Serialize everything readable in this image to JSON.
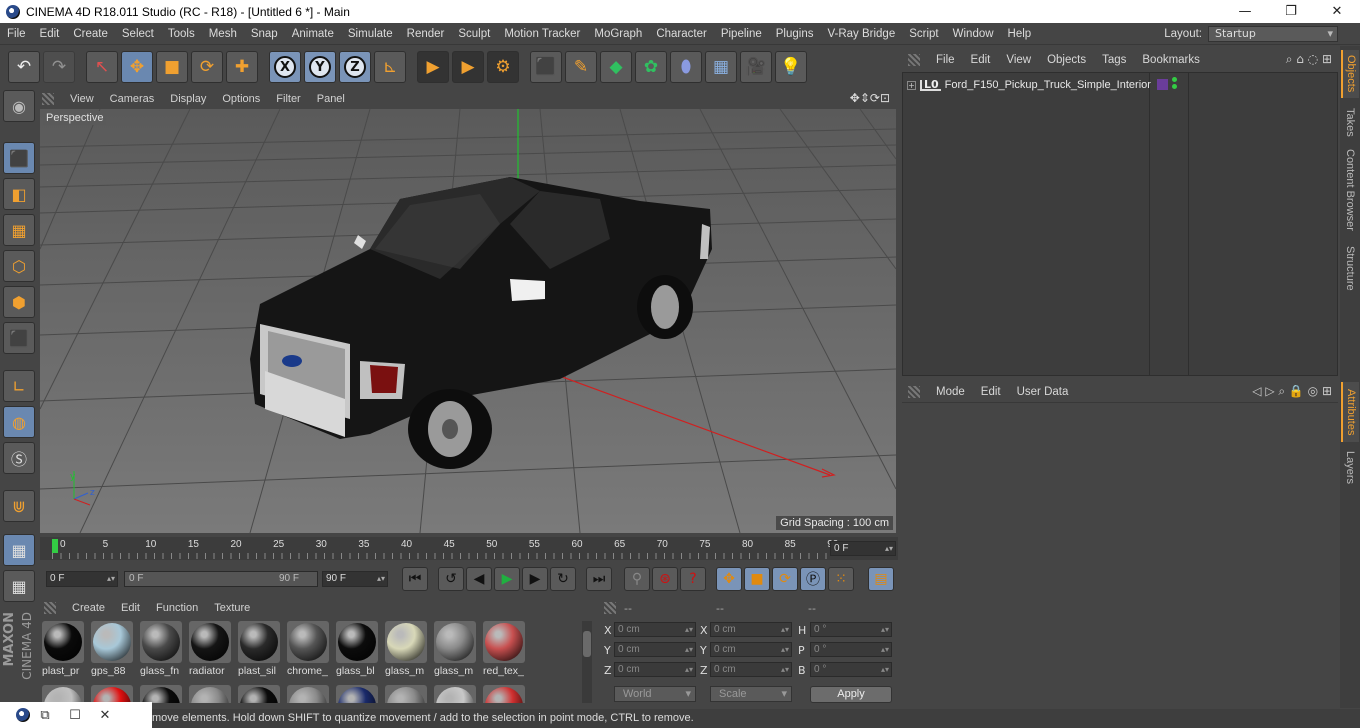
{
  "window": {
    "title": "CINEMA 4D R18.011 Studio (RC - R18) - [Untitled 6 *] - Main",
    "minimize": "—",
    "maximize": "❐",
    "close": "✕"
  },
  "menubar": {
    "items": [
      "File",
      "Edit",
      "Create",
      "Select",
      "Tools",
      "Mesh",
      "Snap",
      "Animate",
      "Simulate",
      "Render",
      "Sculpt",
      "Motion Tracker",
      "MoGraph",
      "Character",
      "Pipeline",
      "Plugins",
      "V-Ray Bridge",
      "Script",
      "Window",
      "Help"
    ],
    "layout_label": "Layout:",
    "layout_value": "Startup"
  },
  "toolbar": {
    "undo": "↶",
    "redo": "↷",
    "select": "↖",
    "move": "✥",
    "scale": "■",
    "rotate": "⟳",
    "add": "✚",
    "axis_x": "X",
    "axis_y": "Y",
    "axis_z": "Z",
    "coord": "⊾",
    "render_view": "▶",
    "render_pic": "▶",
    "render_settings": "⚙",
    "cube": "⬛",
    "pen": "✎",
    "subdiv": "◆",
    "cloner": "✿",
    "deformer": "⬮",
    "floor": "▦",
    "camera": "🎥",
    "light": "💡"
  },
  "viewport": {
    "menu": [
      "View",
      "Cameras",
      "Display",
      "Options",
      "Filter",
      "Panel"
    ],
    "label": "Perspective",
    "grid_spacing": "Grid Spacing : 100 cm",
    "nav_icons": "✥⇕⟳⊡"
  },
  "timeline": {
    "ticks": [
      "0",
      "5",
      "10",
      "15",
      "20",
      "25",
      "30",
      "35",
      "40",
      "45",
      "50",
      "55",
      "60",
      "65",
      "70",
      "75",
      "80",
      "85",
      "90"
    ],
    "current_frame": "0 F"
  },
  "transport": {
    "start_field": "0 F",
    "range_start": "0 F",
    "range_end": "90 F",
    "end_field": "90 F",
    "goto_start": "⏮",
    "prev_key": "↺",
    "prev_frame": "◀",
    "play": "▶",
    "next_frame": "▶",
    "next_key": "↻",
    "goto_end": "⏭"
  },
  "materials": {
    "menu": [
      "Create",
      "Edit",
      "Function",
      "Texture"
    ],
    "items": [
      {
        "name": "plast_pr",
        "color": "#0a0a0a"
      },
      {
        "name": "gps_88",
        "color": "#a8c8d8"
      },
      {
        "name": "glass_fn",
        "color": "#4a4a4a"
      },
      {
        "name": "radiator",
        "color": "#151515"
      },
      {
        "name": "plast_sil",
        "color": "#2a2a2a"
      },
      {
        "name": "chrome_",
        "color": "#555555"
      },
      {
        "name": "glass_bl",
        "color": "#0c0c0c"
      },
      {
        "name": "glass_m",
        "color": "#d8d8b8"
      },
      {
        "name": "glass_m",
        "color": "#8a8a8a"
      },
      {
        "name": "red_tex_",
        "color": "#c85050"
      }
    ],
    "row2": [
      {
        "color": "#c0c0c0"
      },
      {
        "color": "#e01010"
      },
      {
        "color": "#0a0a0a"
      },
      {
        "color": "#8a8a8a"
      },
      {
        "color": "#0a0a0a"
      },
      {
        "color": "#8a8a8a"
      },
      {
        "color": "#1a2a6a"
      },
      {
        "color": "#8a8a8a"
      },
      {
        "color": "#c8c8c8"
      },
      {
        "color": "#d03030"
      }
    ]
  },
  "coordinates": {
    "headers": [
      "--",
      "--",
      "--"
    ],
    "rows": [
      {
        "a": "X",
        "av": "0 cm",
        "b": "X",
        "bv": "0 cm",
        "c": "H",
        "cv": "0 °"
      },
      {
        "a": "Y",
        "av": "0 cm",
        "b": "Y",
        "bv": "0 cm",
        "c": "P",
        "cv": "0 °"
      },
      {
        "a": "Z",
        "av": "0 cm",
        "b": "Z",
        "bv": "0 cm",
        "c": "B",
        "cv": "0 °"
      }
    ],
    "world": "World",
    "scale": "Scale",
    "apply": "Apply"
  },
  "objects": {
    "menu": [
      "File",
      "Edit",
      "View",
      "Objects",
      "Tags",
      "Bookmarks"
    ],
    "icons": "⌕ ⌂ ◌ ⊞",
    "items": [
      {
        "name": "Ford_F150_Pickup_Truck_Simple_Interior",
        "expand": "+",
        "layer": "L0"
      }
    ]
  },
  "attributes": {
    "menu": [
      "Mode",
      "Edit",
      "User Data"
    ],
    "icons": "◁ ▷ ⌕ 🔒 ◎ ⊞"
  },
  "sidetabs": [
    "Objects",
    "Takes",
    "Content Browser",
    "Structure",
    "Attributes",
    "Layers"
  ],
  "status": "move elements. Hold down SHIFT to quantize movement / add to the selection in point mode, CTRL to remove.",
  "taskbar": {
    "restore": "⧉",
    "maximize": "☐",
    "close": "✕"
  }
}
